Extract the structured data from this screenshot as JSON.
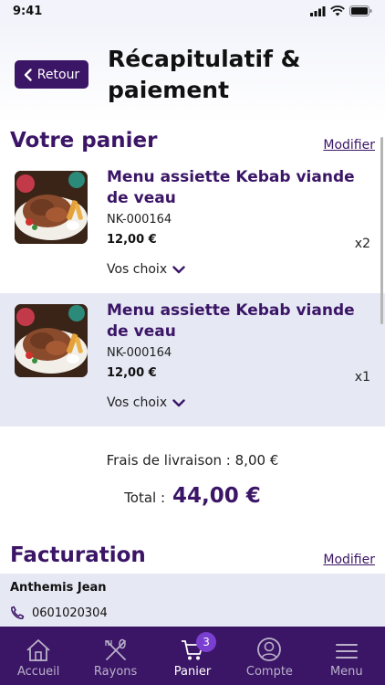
{
  "status": {
    "time": "9:41"
  },
  "header": {
    "back_label": "Retour",
    "title": "Récapitulatif & paiement"
  },
  "cart": {
    "title": "Votre panier",
    "edit_label": "Modifier",
    "items": [
      {
        "name": "Menu assiette Kebab viande de veau",
        "ref": "NK-000164",
        "price": "12,00 €",
        "qty": "x2",
        "choices_label": "Vos choix"
      },
      {
        "name": "Menu assiette Kebab viande de veau",
        "ref": "NK-000164",
        "price": "12,00 €",
        "qty": "x1",
        "choices_label": "Vos choix"
      }
    ],
    "delivery": "Frais de livraison : 8,00 €",
    "total_label": "Total :",
    "total_value": "44,00 €"
  },
  "billing": {
    "title": "Facturation",
    "edit_label": "Modifier",
    "name": "Anthemis Jean",
    "phone": "0601020304"
  },
  "tabbar": {
    "tabs": [
      {
        "label": "Accueil",
        "icon": "home-icon"
      },
      {
        "label": "Rayons",
        "icon": "utensils-icon"
      },
      {
        "label": "Panier",
        "icon": "cart-icon",
        "badge": "3",
        "active": true
      },
      {
        "label": "Compte",
        "icon": "user-icon"
      },
      {
        "label": "Menu",
        "icon": "menu-icon"
      }
    ]
  },
  "colors": {
    "brand": "#3b1566",
    "highlight": "#e6e8f4",
    "badge": "#7a3fd0"
  }
}
